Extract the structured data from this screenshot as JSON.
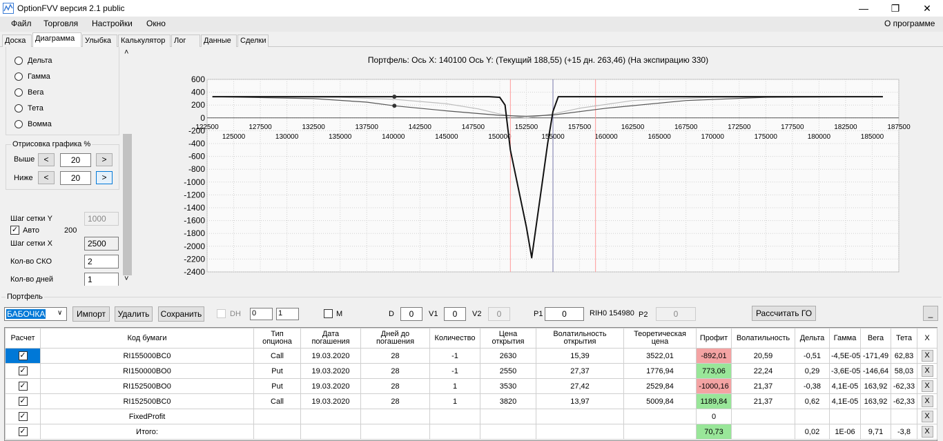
{
  "window": {
    "title": "OptionFVV версия 2.1 public"
  },
  "menu": {
    "file": "Файл",
    "trade": "Торговля",
    "settings": "Настройки",
    "window": "Окно",
    "about": "О программе"
  },
  "tabs": [
    "Доска",
    "Диаграмма",
    "Улыбка",
    "Калькулятор",
    "Лог",
    "Данные",
    "Сделки"
  ],
  "left": {
    "radios": [
      "Дельта",
      "Гамма",
      "Вега",
      "Тета",
      "Вомма"
    ],
    "render_group": "Отрисовка графика %",
    "above_label": "Выше",
    "above_value": "20",
    "below_label": "Ниже",
    "below_value": "20",
    "btn_less": "<",
    "btn_more": ">",
    "grid_y_label": "Шаг сетки Y",
    "grid_y_value": "1000",
    "auto_label": "Авто",
    "auto_value": "200",
    "grid_x_label": "Шаг сетки X",
    "grid_x_value": "2500",
    "sko_label": "Кол-во СКО",
    "sko_value": "2",
    "days_label": "Кол-во дней",
    "days_value": "1",
    "scroll_up": "˄",
    "scroll_down": "˅"
  },
  "chart": {
    "title": "Портфель:  Ось X:  140100  Ось Y:   (Текущий 188,55)   (+15 дн. 263,46)   (На экспирацию 330)"
  },
  "chart_data": {
    "type": "line",
    "title": "Портфель:  Ось X:  140100  Ось Y:   (Текущий 188,55)   (+15 дн. 263,46)   (На экспирацию 330)",
    "ylim": [
      -2400,
      600
    ],
    "xlim": [
      122500,
      187500
    ],
    "y_ticks": [
      600,
      400,
      200,
      0,
      -200,
      -400,
      -600,
      -800,
      -1000,
      -1200,
      -1400,
      -1600,
      -1800,
      -2000,
      -2200,
      -2400
    ],
    "x_ticks_upper": [
      122500,
      127500,
      132500,
      137500,
      142500,
      147500,
      152500,
      157500,
      162500,
      167500,
      172500,
      177500,
      182500,
      187500
    ],
    "x_ticks_lower": [
      125000,
      130000,
      135000,
      140000,
      145000,
      150000,
      155000,
      160000,
      165000,
      170000,
      175000,
      180000,
      185000
    ],
    "grid": true,
    "vlines": [
      {
        "x": 151000,
        "color": "#ff9999"
      },
      {
        "x": 155000,
        "color": "#7777aa"
      },
      {
        "x": 159000,
        "color": "#ff9999"
      }
    ],
    "markers": [
      {
        "x": 140100,
        "y": 330
      },
      {
        "x": 140100,
        "y": 188.55
      }
    ],
    "series": [
      {
        "label": "expiration",
        "color": "#111111",
        "x": [
          123000,
          140000,
          149000,
          150000,
          150500,
          151000,
          152500,
          153000,
          154000,
          154500,
          155000,
          155500,
          160000,
          186000
        ],
        "y": [
          330,
          330,
          330,
          320,
          200,
          -500,
          -1700,
          -2180,
          -1000,
          -400,
          100,
          330,
          330,
          330
        ]
      },
      {
        "label": "current",
        "color": "#555555",
        "x": [
          123000,
          132500,
          137500,
          140100,
          145000,
          150000,
          152500,
          155000,
          160000,
          167500,
          175000,
          186000
        ],
        "y": [
          330,
          300,
          245,
          188,
          110,
          40,
          25,
          45,
          150,
          270,
          320,
          330
        ]
      },
      {
        "label": "+15 days",
        "color": "#bbbbbb",
        "x": [
          123000,
          135000,
          140000,
          145000,
          148000,
          150000,
          152500,
          155000,
          157500,
          162500,
          170000,
          186000
        ],
        "y": [
          330,
          320,
          290,
          220,
          140,
          60,
          0,
          60,
          150,
          270,
          320,
          330
        ]
      }
    ]
  },
  "portfolio": {
    "group_label": "Портфель",
    "selected": "БАБОЧКА",
    "import_btn": "Импорт",
    "delete_btn": "Удалить",
    "save_btn": "Сохранить",
    "dh_label": "DH",
    "dh_a": "0",
    "dh_b": "1",
    "m_label": "M",
    "d_label": "D",
    "d_value": "0",
    "v1_label": "V1",
    "v1_value": "0",
    "v2_label": "V2",
    "v2_value": "0",
    "p1_label": "P1",
    "p1_value": "0",
    "rih_label": "RIH0 154980",
    "p2_label": "P2",
    "p2_value": "0",
    "calc_btn": "Рассчитать ГО",
    "min_btn": "_"
  },
  "table": {
    "headers": [
      "Расчет",
      "Код бумаги",
      "Тип опциона",
      "Дата погашения",
      "Дней до погашения",
      "Количество",
      "Цена открытия",
      "Волатильность открытия",
      "Теоретическая цена",
      "Профит",
      "Волатильность",
      "Дельта",
      "Гамма",
      "Вега",
      "Тета",
      "X"
    ],
    "rows": [
      {
        "check": "✓",
        "code": "RI155000BC0",
        "type": "Call",
        "date": "19.03.2020",
        "days": "28",
        "qty": "-1",
        "price": "2630",
        "vol_open": "15,39",
        "theo": "3522,01",
        "profit": "-892,01",
        "profit_state": "neg",
        "vol": "20,59",
        "delta": "-0,51",
        "gamma": "-4,5E-05",
        "vega": "-171,49",
        "theta": "62,83",
        "x": "X"
      },
      {
        "check": "✓",
        "code": "RI150000BO0",
        "type": "Put",
        "date": "19.03.2020",
        "days": "28",
        "qty": "-1",
        "price": "2550",
        "vol_open": "27,37",
        "theo": "1776,94",
        "profit": "773,06",
        "profit_state": "pos",
        "vol": "22,24",
        "delta": "0,29",
        "gamma": "-3,6E-05",
        "vega": "-146,64",
        "theta": "58,03",
        "x": "X"
      },
      {
        "check": "✓",
        "code": "RI152500BO0",
        "type": "Put",
        "date": "19.03.2020",
        "days": "28",
        "qty": "1",
        "price": "3530",
        "vol_open": "27,42",
        "theo": "2529,84",
        "profit": "-1000,16",
        "profit_state": "neg",
        "vol": "21,37",
        "delta": "-0,38",
        "gamma": "4,1E-05",
        "vega": "163,92",
        "theta": "-62,33",
        "x": "X"
      },
      {
        "check": "✓",
        "code": "RI152500BC0",
        "type": "Call",
        "date": "19.03.2020",
        "days": "28",
        "qty": "1",
        "price": "3820",
        "vol_open": "13,97",
        "theo": "5009,84",
        "profit": "1189,84",
        "profit_state": "pos",
        "vol": "21,37",
        "delta": "0,62",
        "gamma": "4,1E-05",
        "vega": "163,92",
        "theta": "-62,33",
        "x": "X"
      },
      {
        "check": "✓",
        "code": "FixedProfit",
        "type": "",
        "date": "",
        "days": "",
        "qty": "",
        "price": "",
        "vol_open": "",
        "theo": "",
        "profit": "0",
        "profit_state": "none",
        "vol": "",
        "delta": "",
        "gamma": "",
        "vega": "",
        "theta": "",
        "x": "X"
      },
      {
        "check": "✓",
        "code": "Итого:",
        "type": "",
        "date": "",
        "days": "",
        "qty": "",
        "price": "",
        "vol_open": "",
        "theo": "",
        "profit": "70,73",
        "profit_state": "pos",
        "vol": "",
        "delta": "0,02",
        "gamma": "1E-06",
        "vega": "9,71",
        "theta": "-3,8",
        "x": "X"
      }
    ]
  }
}
